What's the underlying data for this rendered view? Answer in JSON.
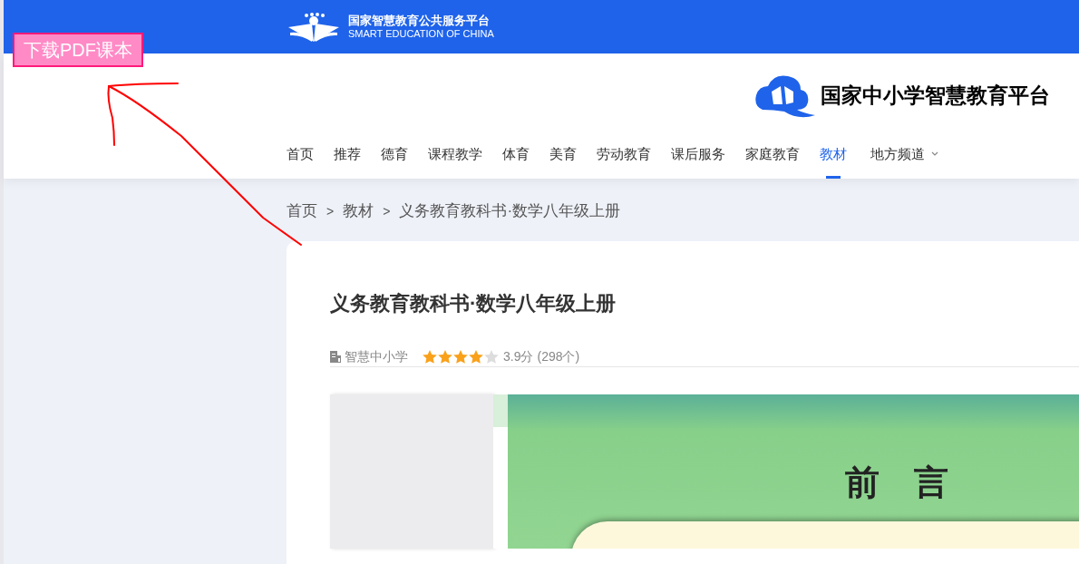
{
  "download_button": {
    "label": "下载PDF课本"
  },
  "header": {
    "platform_name": "国家智慧教育公共服务平台",
    "platform_name_en": "SMART EDUCATION OF CHINA"
  },
  "site_logo": {
    "title": "国家中小学智慧教育平台"
  },
  "nav": [
    {
      "label": "首页",
      "selected": false
    },
    {
      "label": "推荐",
      "selected": false
    },
    {
      "label": "德育",
      "selected": false
    },
    {
      "label": "课程教学",
      "selected": false
    },
    {
      "label": "体育",
      "selected": false
    },
    {
      "label": "美育",
      "selected": false
    },
    {
      "label": "劳动教育",
      "selected": false
    },
    {
      "label": "课后服务",
      "selected": false
    },
    {
      "label": "家庭教育",
      "selected": false
    },
    {
      "label": "教材",
      "selected": true
    },
    {
      "label": "地方频道",
      "selected": false,
      "dropdown": true
    }
  ],
  "breadcrumb": [
    {
      "label": "首页"
    },
    {
      "label": "教材",
      "separator": ">"
    },
    {
      "label": "义务教育教科书·数学八年级上册",
      "separator": ">"
    }
  ],
  "book": {
    "title": "义务教育教科书·数学八年级上册",
    "publisher": "智慧中小学",
    "stars": 4,
    "score": "3.9分",
    "ratings": "(298个)"
  },
  "page_preview": {
    "heading": "前　言"
  }
}
